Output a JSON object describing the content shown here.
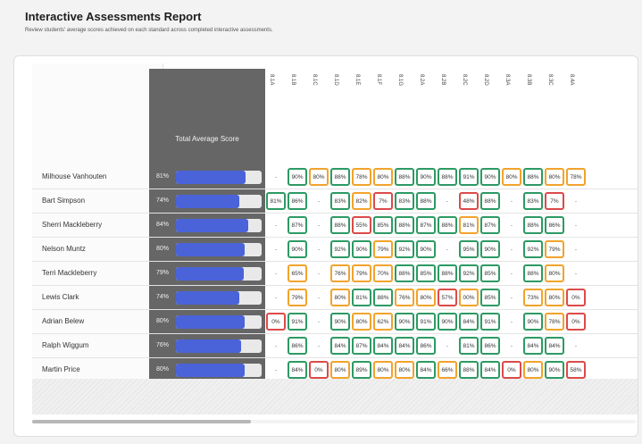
{
  "report": {
    "title": "Interactive Assessments Report",
    "subtitle": "Review students' average scores achieved on each standard across completed interactive assessments."
  },
  "table": {
    "total_header": "Total Average Score",
    "standards": [
      "8.1A",
      "8.1B",
      "8.1C",
      "8.1D",
      "8.1E",
      "8.1F",
      "8.1G",
      "8.2A",
      "8.2B",
      "8.2C",
      "8.2D",
      "8.3A",
      "8.3B",
      "8.3C",
      "8.4A"
    ],
    "students": [
      {
        "name": "Milhouse Vanhouten",
        "avg": "81%",
        "fill": 0.81,
        "scores": [
          {
            "v": "-",
            "s": "n"
          },
          {
            "v": "90%",
            "s": "g"
          },
          {
            "v": "80%",
            "s": "o"
          },
          {
            "v": "88%",
            "s": "g"
          },
          {
            "v": "78%",
            "s": "o"
          },
          {
            "v": "80%",
            "s": "o"
          },
          {
            "v": "88%",
            "s": "g"
          },
          {
            "v": "90%",
            "s": "g"
          },
          {
            "v": "88%",
            "s": "g"
          },
          {
            "v": "91%",
            "s": "g"
          },
          {
            "v": "90%",
            "s": "g"
          },
          {
            "v": "80%",
            "s": "o"
          },
          {
            "v": "88%",
            "s": "g"
          },
          {
            "v": "80%",
            "s": "o"
          },
          {
            "v": "78%",
            "s": "o"
          }
        ]
      },
      {
        "name": "Bart Simpson",
        "avg": "74%",
        "fill": 0.74,
        "scores": [
          {
            "v": "81%",
            "s": "g"
          },
          {
            "v": "86%",
            "s": "g"
          },
          {
            "v": "-",
            "s": "n"
          },
          {
            "v": "83%",
            "s": "g"
          },
          {
            "v": "82%",
            "s": "o"
          },
          {
            "v": "7%",
            "s": "r"
          },
          {
            "v": "83%",
            "s": "g"
          },
          {
            "v": "88%",
            "s": "g"
          },
          {
            "v": "-",
            "s": "n"
          },
          {
            "v": "48%",
            "s": "r"
          },
          {
            "v": "88%",
            "s": "g"
          },
          {
            "v": "-",
            "s": "n"
          },
          {
            "v": "83%",
            "s": "g"
          },
          {
            "v": "7%",
            "s": "r"
          },
          {
            "v": "-",
            "s": "n"
          }
        ]
      },
      {
        "name": "Sherri Mackleberry",
        "avg": "84%",
        "fill": 0.84,
        "scores": [
          {
            "v": "-",
            "s": "n"
          },
          {
            "v": "87%",
            "s": "g"
          },
          {
            "v": "-",
            "s": "n"
          },
          {
            "v": "88%",
            "s": "g"
          },
          {
            "v": "55%",
            "s": "r"
          },
          {
            "v": "85%",
            "s": "g"
          },
          {
            "v": "88%",
            "s": "g"
          },
          {
            "v": "87%",
            "s": "g"
          },
          {
            "v": "88%",
            "s": "g"
          },
          {
            "v": "81%",
            "s": "o"
          },
          {
            "v": "87%",
            "s": "g"
          },
          {
            "v": "-",
            "s": "n"
          },
          {
            "v": "88%",
            "s": "g"
          },
          {
            "v": "86%",
            "s": "g"
          },
          {
            "v": "-",
            "s": "n"
          }
        ]
      },
      {
        "name": "Nelson Muntz",
        "avg": "80%",
        "fill": 0.8,
        "scores": [
          {
            "v": "-",
            "s": "n"
          },
          {
            "v": "90%",
            "s": "g"
          },
          {
            "v": "-",
            "s": "n"
          },
          {
            "v": "92%",
            "s": "g"
          },
          {
            "v": "90%",
            "s": "g"
          },
          {
            "v": "79%",
            "s": "o"
          },
          {
            "v": "92%",
            "s": "g"
          },
          {
            "v": "90%",
            "s": "g"
          },
          {
            "v": "-",
            "s": "n"
          },
          {
            "v": "95%",
            "s": "g"
          },
          {
            "v": "90%",
            "s": "g"
          },
          {
            "v": "-",
            "s": "n"
          },
          {
            "v": "92%",
            "s": "g"
          },
          {
            "v": "79%",
            "s": "o"
          },
          {
            "v": "-",
            "s": "n"
          }
        ]
      },
      {
        "name": "Terri Mackleberry",
        "avg": "79%",
        "fill": 0.79,
        "scores": [
          {
            "v": "-",
            "s": "n"
          },
          {
            "v": "65%",
            "s": "o"
          },
          {
            "v": "-",
            "s": "n"
          },
          {
            "v": "76%",
            "s": "o"
          },
          {
            "v": "79%",
            "s": "o"
          },
          {
            "v": "70%",
            "s": "o"
          },
          {
            "v": "88%",
            "s": "g"
          },
          {
            "v": "85%",
            "s": "g"
          },
          {
            "v": "88%",
            "s": "g"
          },
          {
            "v": "92%",
            "s": "g"
          },
          {
            "v": "85%",
            "s": "g"
          },
          {
            "v": "-",
            "s": "n"
          },
          {
            "v": "88%",
            "s": "g"
          },
          {
            "v": "80%",
            "s": "o"
          },
          {
            "v": "-",
            "s": "n"
          }
        ]
      },
      {
        "name": "Lewis Clark",
        "avg": "74%",
        "fill": 0.74,
        "scores": [
          {
            "v": "-",
            "s": "n"
          },
          {
            "v": "79%",
            "s": "o"
          },
          {
            "v": "-",
            "s": "n"
          },
          {
            "v": "80%",
            "s": "o"
          },
          {
            "v": "81%",
            "s": "g"
          },
          {
            "v": "88%",
            "s": "g"
          },
          {
            "v": "76%",
            "s": "o"
          },
          {
            "v": "80%",
            "s": "o"
          },
          {
            "v": "57%",
            "s": "r"
          },
          {
            "v": "00%",
            "s": "o"
          },
          {
            "v": "85%",
            "s": "g"
          },
          {
            "v": "-",
            "s": "n"
          },
          {
            "v": "73%",
            "s": "o"
          },
          {
            "v": "80%",
            "s": "o"
          },
          {
            "v": "0%",
            "s": "r"
          }
        ]
      },
      {
        "name": "Adrian Belew",
        "avg": "80%",
        "fill": 0.8,
        "scores": [
          {
            "v": "0%",
            "s": "r"
          },
          {
            "v": "91%",
            "s": "g"
          },
          {
            "v": "-",
            "s": "n"
          },
          {
            "v": "90%",
            "s": "g"
          },
          {
            "v": "80%",
            "s": "o"
          },
          {
            "v": "62%",
            "s": "o"
          },
          {
            "v": "90%",
            "s": "g"
          },
          {
            "v": "91%",
            "s": "g"
          },
          {
            "v": "90%",
            "s": "g"
          },
          {
            "v": "84%",
            "s": "g"
          },
          {
            "v": "91%",
            "s": "g"
          },
          {
            "v": "-",
            "s": "n"
          },
          {
            "v": "90%",
            "s": "g"
          },
          {
            "v": "78%",
            "s": "o"
          },
          {
            "v": "0%",
            "s": "r"
          }
        ]
      },
      {
        "name": "Ralph Wiggum",
        "avg": "76%",
        "fill": 0.76,
        "scores": [
          {
            "v": "-",
            "s": "n"
          },
          {
            "v": "86%",
            "s": "g"
          },
          {
            "v": "-",
            "s": "n"
          },
          {
            "v": "84%",
            "s": "g"
          },
          {
            "v": "87%",
            "s": "g"
          },
          {
            "v": "84%",
            "s": "g"
          },
          {
            "v": "84%",
            "s": "g"
          },
          {
            "v": "86%",
            "s": "g"
          },
          {
            "v": "-",
            "s": "n"
          },
          {
            "v": "81%",
            "s": "g"
          },
          {
            "v": "86%",
            "s": "g"
          },
          {
            "v": "-",
            "s": "n"
          },
          {
            "v": "84%",
            "s": "g"
          },
          {
            "v": "84%",
            "s": "g"
          },
          {
            "v": "-",
            "s": "n"
          }
        ]
      },
      {
        "name": "Martin Price",
        "avg": "80%",
        "fill": 0.8,
        "scores": [
          {
            "v": "-",
            "s": "n"
          },
          {
            "v": "84%",
            "s": "g"
          },
          {
            "v": "0%",
            "s": "r"
          },
          {
            "v": "80%",
            "s": "o"
          },
          {
            "v": "89%",
            "s": "g"
          },
          {
            "v": "80%",
            "s": "o"
          },
          {
            "v": "80%",
            "s": "o"
          },
          {
            "v": "84%",
            "s": "g"
          },
          {
            "v": "66%",
            "s": "o"
          },
          {
            "v": "88%",
            "s": "g"
          },
          {
            "v": "84%",
            "s": "g"
          },
          {
            "v": "0%",
            "s": "r"
          },
          {
            "v": "80%",
            "s": "o"
          },
          {
            "v": "90%",
            "s": "g"
          },
          {
            "v": "58%",
            "s": "r"
          }
        ]
      }
    ]
  },
  "colors": {
    "bar_fill": "#4a63d8",
    "mastered": "#2d9a63",
    "approaching": "#f2a32c",
    "not_mastered": "#dc4a4a"
  }
}
